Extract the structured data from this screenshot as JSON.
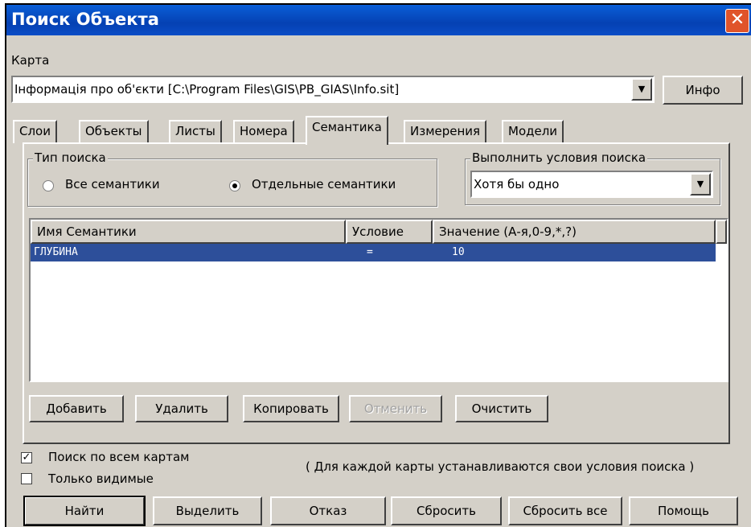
{
  "window": {
    "title": "Поиск Объекта",
    "close_glyph": "✕"
  },
  "map": {
    "label": "Карта",
    "selected": "Інформація про об'єкти     [C:\\Program Files\\GIS\\PB_GIAS\\Info.sit]",
    "info_button": "Инфо"
  },
  "tabs": [
    {
      "label": "Слои"
    },
    {
      "label": "Объекты"
    },
    {
      "label": "Листы"
    },
    {
      "label": "Номера"
    },
    {
      "label": "Семантика",
      "active": true
    },
    {
      "label": "Измерения"
    },
    {
      "label": "Модели"
    }
  ],
  "search_type": {
    "legend": "Тип поиска",
    "options": [
      {
        "label": "Все семантики",
        "selected": false
      },
      {
        "label": "Отдельные семантики",
        "selected": true
      }
    ]
  },
  "conditions": {
    "legend": "Выполнить условия поиска",
    "selected": "Хотя бы одно"
  },
  "table": {
    "columns": [
      "Имя Семантики",
      "Условие",
      "Значение  (А-я,0-9,*,?)"
    ],
    "rows": [
      {
        "name": "ГЛУБИНА",
        "condition": "=",
        "value": "10",
        "selected": true
      }
    ]
  },
  "table_buttons": {
    "add": "Добавить",
    "delete": "Удалить",
    "copy": "Копировать",
    "cancel": "Отменить",
    "clear": "Очистить"
  },
  "options": {
    "all_maps": {
      "label": "Поиск по всем картам",
      "checked": true
    },
    "visible_only": {
      "label": "Только видимые",
      "checked": false
    },
    "note": "( Для каждой карты устанавливаются свои условия поиска )"
  },
  "bottom_buttons": {
    "find": "Найти",
    "select": "Выделить",
    "cancel": "Отказ",
    "reset": "Сбросить",
    "reset_all": "Сбросить все",
    "help": "Помощь"
  },
  "colors": {
    "title_bar": "#0541b3",
    "selection": "#2d4f9a",
    "face": "#d4d0c8"
  }
}
